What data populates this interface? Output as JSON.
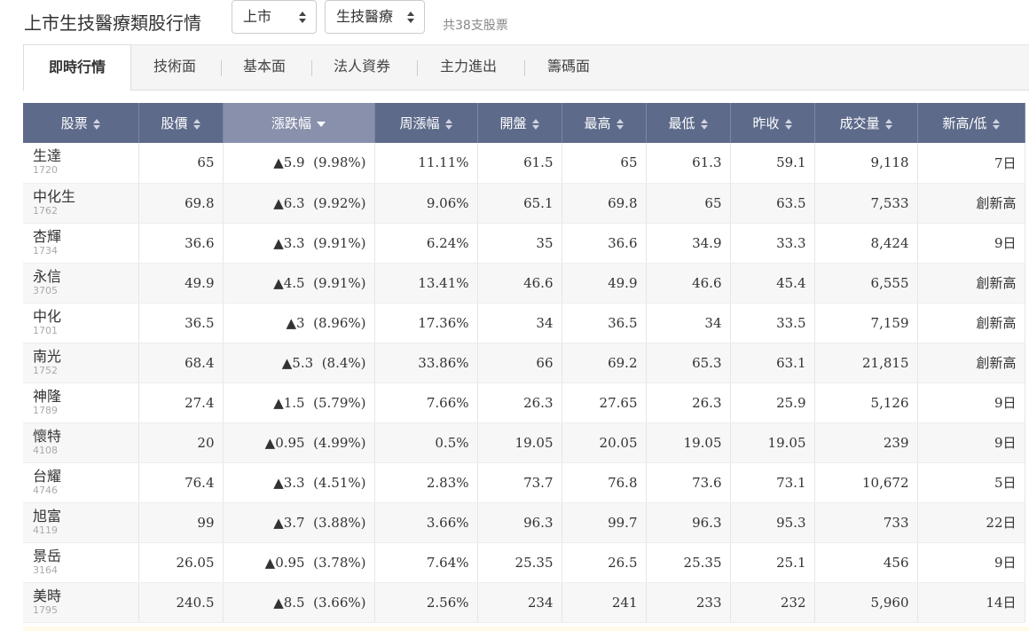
{
  "header": {
    "title": "上市生技醫療類股行情",
    "market_select": "上市",
    "sector_select": "生技醫療",
    "count": "共38支股票"
  },
  "tabs": [
    "即時行情",
    "技術面",
    "基本面",
    "法人資券",
    "主力進出",
    "籌碼面"
  ],
  "table": {
    "columns": [
      "股票",
      "股價",
      "漲跌幅",
      "周漲幅",
      "開盤",
      "最高",
      "最低",
      "昨收",
      "成交量",
      "新高/低"
    ],
    "sorted_column": "漲跌幅",
    "rows": [
      {
        "name": "生達",
        "code": "1720",
        "price": "65",
        "change": "▲5.9",
        "pct": "(9.98%)",
        "week": "11.11%",
        "open": "61.5",
        "high": "65",
        "low": "61.3",
        "prev": "59.1",
        "volume": "9,118",
        "newhl": "7日"
      },
      {
        "name": "中化生",
        "code": "1762",
        "price": "69.8",
        "change": "▲6.3",
        "pct": "(9.92%)",
        "week": "9.06%",
        "open": "65.1",
        "high": "69.8",
        "low": "65",
        "prev": "63.5",
        "volume": "7,533",
        "newhl": "創新高"
      },
      {
        "name": "杏輝",
        "code": "1734",
        "price": "36.6",
        "change": "▲3.3",
        "pct": "(9.91%)",
        "week": "6.24%",
        "open": "35",
        "high": "36.6",
        "low": "34.9",
        "prev": "33.3",
        "volume": "8,424",
        "newhl": "9日"
      },
      {
        "name": "永信",
        "code": "3705",
        "price": "49.9",
        "change": "▲4.5",
        "pct": "(9.91%)",
        "week": "13.41%",
        "open": "46.6",
        "high": "49.9",
        "low": "46.6",
        "prev": "45.4",
        "volume": "6,555",
        "newhl": "創新高"
      },
      {
        "name": "中化",
        "code": "1701",
        "price": "36.5",
        "change": "▲3",
        "pct": "(8.96%)",
        "week": "17.36%",
        "open": "34",
        "high": "36.5",
        "low": "34",
        "prev": "33.5",
        "volume": "7,159",
        "newhl": "創新高"
      },
      {
        "name": "南光",
        "code": "1752",
        "price": "68.4",
        "change": "▲5.3",
        "pct": "(8.4%)",
        "week": "33.86%",
        "open": "66",
        "high": "69.2",
        "low": "65.3",
        "prev": "63.1",
        "volume": "21,815",
        "newhl": "創新高"
      },
      {
        "name": "神隆",
        "code": "1789",
        "price": "27.4",
        "change": "▲1.5",
        "pct": "(5.79%)",
        "week": "7.66%",
        "open": "26.3",
        "high": "27.65",
        "low": "26.3",
        "prev": "25.9",
        "volume": "5,126",
        "newhl": "9日"
      },
      {
        "name": "懷特",
        "code": "4108",
        "price": "20",
        "change": "▲0.95",
        "pct": "(4.99%)",
        "week": "0.5%",
        "open": "19.05",
        "high": "20.05",
        "low": "19.05",
        "prev": "19.05",
        "volume": "239",
        "newhl": "9日"
      },
      {
        "name": "台耀",
        "code": "4746",
        "price": "76.4",
        "change": "▲3.3",
        "pct": "(4.51%)",
        "week": "2.83%",
        "open": "73.7",
        "high": "76.8",
        "low": "73.6",
        "prev": "73.1",
        "volume": "10,672",
        "newhl": "5日"
      },
      {
        "name": "旭富",
        "code": "4119",
        "price": "99",
        "change": "▲3.7",
        "pct": "(3.88%)",
        "week": "3.66%",
        "open": "96.3",
        "high": "99.7",
        "low": "96.3",
        "prev": "95.3",
        "volume": "733",
        "newhl": "22日"
      },
      {
        "name": "景岳",
        "code": "3164",
        "price": "26.05",
        "change": "▲0.95",
        "pct": "(3.78%)",
        "week": "7.64%",
        "open": "25.35",
        "high": "26.5",
        "low": "25.35",
        "prev": "25.1",
        "volume": "456",
        "newhl": "9日"
      },
      {
        "name": "美時",
        "code": "1795",
        "price": "240.5",
        "change": "▲8.5",
        "pct": "(3.66%)",
        "week": "2.56%",
        "open": "234",
        "high": "241",
        "low": "233",
        "prev": "232",
        "volume": "5,960",
        "newhl": "14日"
      }
    ],
    "red_cells": {
      "1720": [
        "price",
        "change",
        "week",
        "open",
        "high",
        "low"
      ],
      "1762": [
        "price",
        "change",
        "week",
        "open",
        "high",
        "low"
      ],
      "1734": [
        "price",
        "change",
        "week",
        "open",
        "high",
        "low"
      ],
      "3705": [
        "price",
        "change",
        "week",
        "open",
        "high",
        "low"
      ],
      "1701": [
        "price",
        "change",
        "week",
        "open",
        "high",
        "low"
      ],
      "1752": [
        "price",
        "change",
        "week",
        "open",
        "high",
        "low"
      ],
      "1789": [
        "price",
        "change",
        "week",
        "open",
        "high",
        "low"
      ],
      "4108": [
        "price",
        "change",
        "week",
        "high"
      ],
      "4746": [
        "price",
        "change",
        "week",
        "open",
        "high",
        "low"
      ],
      "4119": [
        "price",
        "change",
        "week",
        "open",
        "high",
        "low"
      ],
      "3164": [
        "price",
        "change",
        "week",
        "open",
        "high",
        "low"
      ],
      "1795": [
        "price",
        "change",
        "week",
        "open",
        "high",
        "low"
      ]
    }
  },
  "colors": {
    "up": "#e0212a",
    "header_bg": "#5d6a8a",
    "sorted_header_bg": "#8890ac"
  }
}
